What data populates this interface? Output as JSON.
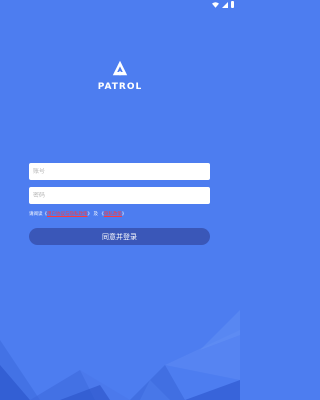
{
  "app": {
    "name": "PATROL"
  },
  "icons": {
    "logo": "pine-tree-icon",
    "wifi": "wifi-icon",
    "signal": "signal-icon",
    "battery": "battery-icon"
  },
  "form": {
    "account_placeholder": "账号",
    "password_placeholder": "密码",
    "account_value": "",
    "password_value": ""
  },
  "agreement": {
    "prefix": "请阅读",
    "open_quote_1": "《",
    "user_agreement": "用户协议与隐私政策",
    "close_quote_1": "》",
    "and": "及",
    "open_quote_2": "《",
    "privacy_policy": "隐私政策",
    "close_quote_2": "》"
  },
  "login_button": {
    "label": "同意并登录"
  },
  "colors": {
    "background": "#4d7df0",
    "button": "#3a57b8",
    "link": "#ff3b3b"
  }
}
